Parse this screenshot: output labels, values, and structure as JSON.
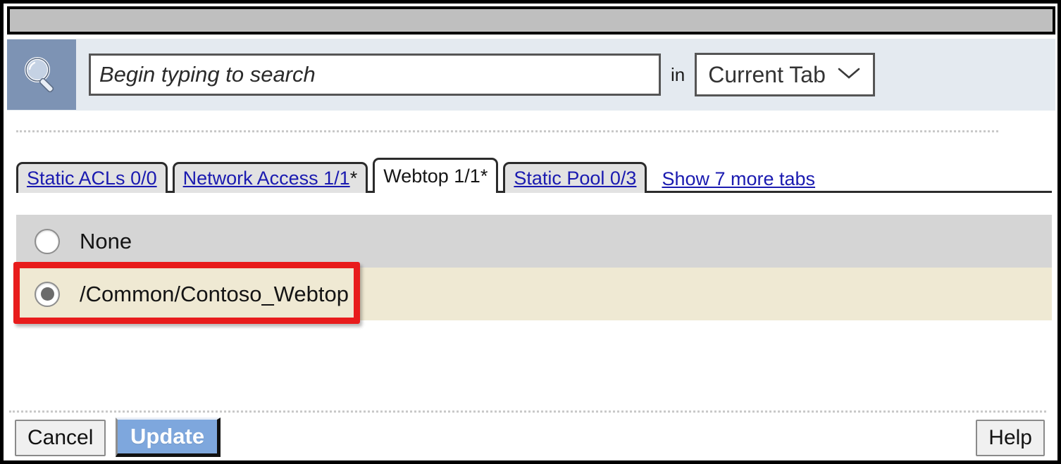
{
  "window": {
    "titlebar_color": "#bfbfbf"
  },
  "search": {
    "icon": "magnifier-icon",
    "placeholder": "Begin typing to search",
    "value": "",
    "in_label": "in",
    "scope_selected": "Current Tab",
    "scope_options": [
      "Current Tab"
    ],
    "chevron_icon": "chevron-down-icon"
  },
  "tabs": {
    "items": [
      {
        "label": "Static ACLs 0/0",
        "star": "",
        "active": false
      },
      {
        "label": "Network Access 1/1",
        "star": "*",
        "active": false
      },
      {
        "label": "Webtop 1/1",
        "star": "*",
        "active": true
      },
      {
        "label": "Static Pool 0/3",
        "star": "",
        "active": false
      }
    ],
    "more_label": "Show 7 more tabs"
  },
  "options": {
    "selected_index": 1,
    "items": [
      {
        "label": "None",
        "selected": false,
        "row_color": "#d5d5d5"
      },
      {
        "label": "/Common/Contoso_Webtop",
        "selected": true,
        "row_color": "#efe9d3"
      }
    ]
  },
  "highlight": {
    "color": "#e81c1c",
    "target": "/Common/Contoso_Webtop"
  },
  "footer": {
    "cancel_label": "Cancel",
    "update_label": "Update",
    "help_label": "Help",
    "update_color": "#7ea7dd"
  }
}
